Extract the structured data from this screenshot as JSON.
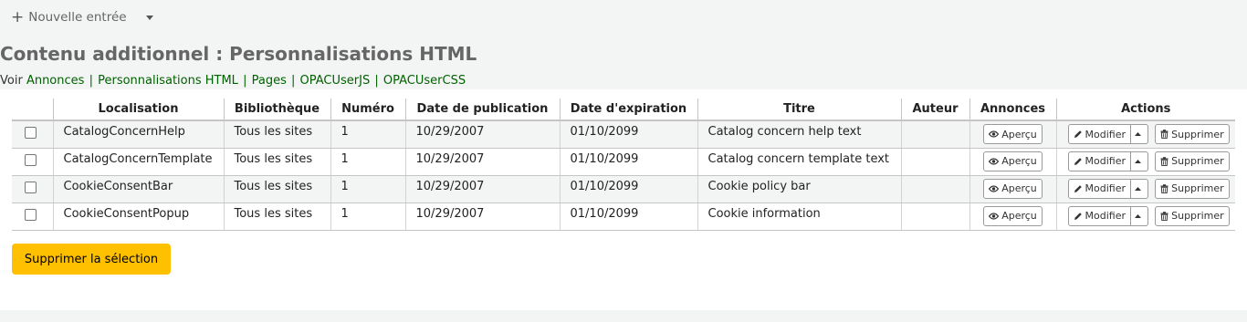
{
  "toolbar": {
    "new_entry_label": "Nouvelle entrée"
  },
  "page_title": "Contenu additionnel : Personnalisations HTML",
  "voir": {
    "prefix": "Voir",
    "links": [
      "Annonces",
      "Personnalisations HTML",
      "Pages",
      "OPACUserJS",
      "OPACUserCSS"
    ],
    "separator": "|"
  },
  "table": {
    "headers": [
      "",
      "Localisation",
      "Bibliothèque",
      "Numéro",
      "Date de publication",
      "Date d'expiration",
      "Titre",
      "Auteur",
      "Annonces",
      "Actions"
    ],
    "rows": [
      {
        "location": "CatalogConcernHelp",
        "library": "Tous les sites",
        "number": "1",
        "published": "10/29/2007",
        "expires": "01/10/2099",
        "title": "Catalog concern help text",
        "author": ""
      },
      {
        "location": "CatalogConcernTemplate",
        "library": "Tous les sites",
        "number": "1",
        "published": "10/29/2007",
        "expires": "01/10/2099",
        "title": "Catalog concern template text",
        "author": ""
      },
      {
        "location": "CookieConsentBar",
        "library": "Tous les sites",
        "number": "1",
        "published": "10/29/2007",
        "expires": "01/10/2099",
        "title": "Cookie policy bar",
        "author": ""
      },
      {
        "location": "CookieConsentPopup",
        "library": "Tous les sites",
        "number": "1",
        "published": "10/29/2007",
        "expires": "01/10/2099",
        "title": "Cookie information",
        "author": ""
      }
    ],
    "buttons": {
      "preview": "Aperçu",
      "edit": "Modifier",
      "delete": "Supprimer"
    }
  },
  "delete_selection_label": "Supprimer la sélection",
  "colors": {
    "link": "#006100",
    "primary_button": "#ffc000",
    "title": "#666666"
  },
  "icons": {
    "new": "plus-icon",
    "menu": "caret-down-icon",
    "preview": "eye-icon",
    "edit": "pencil-icon",
    "delete": "trash-icon",
    "split": "caret-up-icon"
  }
}
